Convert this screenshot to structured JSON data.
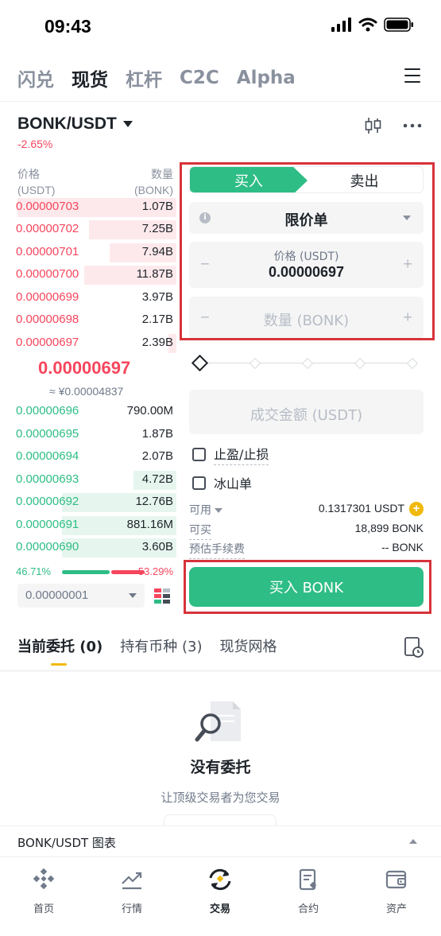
{
  "status": {
    "time": "09:43"
  },
  "top_tabs": [
    {
      "label": "闪兑",
      "active": false
    },
    {
      "label": "现货",
      "active": true
    },
    {
      "label": "杠杆",
      "active": false
    },
    {
      "label": "C2C",
      "active": false
    },
    {
      "label": "Alpha",
      "active": false
    }
  ],
  "pair": {
    "name": "BONK/USDT",
    "change": "-2.65%"
  },
  "orderbook": {
    "price_header": "价格",
    "price_unit": "(USDT)",
    "qty_header": "数量",
    "qty_unit": "(BONK)",
    "asks": [
      {
        "price": "0.00000703",
        "qty": "1.07B",
        "depth": 1.0
      },
      {
        "price": "0.00000702",
        "qty": "7.25B",
        "depth": 0.55
      },
      {
        "price": "0.00000701",
        "qty": "7.94B",
        "depth": 0.42
      },
      {
        "price": "0.00000700",
        "qty": "11.87B",
        "depth": 0.58
      },
      {
        "price": "0.00000699",
        "qty": "3.97B",
        "depth": 0.0
      },
      {
        "price": "0.00000698",
        "qty": "2.17B",
        "depth": 0.0
      },
      {
        "price": "0.00000697",
        "qty": "2.39B",
        "depth": 0.05
      }
    ],
    "last_price": "0.00000697",
    "last_fiat": "≈ ¥0.00004837",
    "bids": [
      {
        "price": "0.00000696",
        "qty": "790.00M",
        "depth": 0.0
      },
      {
        "price": "0.00000695",
        "qty": "1.87B",
        "depth": 0.0
      },
      {
        "price": "0.00000694",
        "qty": "2.07B",
        "depth": 0.0
      },
      {
        "price": "0.00000693",
        "qty": "4.72B",
        "depth": 0.27
      },
      {
        "price": "0.00000692",
        "qty": "12.76B",
        "depth": 0.72
      },
      {
        "price": "0.00000691",
        "qty": "881.16M",
        "depth": 0.72
      },
      {
        "price": "0.00000690",
        "qty": "3.60B",
        "depth": 0.72
      }
    ],
    "buy_ratio": "46.71%",
    "sell_ratio": "53.29%",
    "precision": "0.00000001"
  },
  "form": {
    "buy_label": "买入",
    "sell_label": "卖出",
    "order_type": "限价单",
    "price_label": "价格 (USDT)",
    "price_value": "0.00000697",
    "qty_placeholder": "数量 (BONK)",
    "amount_placeholder": "成交金额 (USDT)",
    "tp_sl": "止盈/止损",
    "iceberg": "冰山单",
    "available_label": "可用",
    "available_value": "0.1317301 USDT",
    "can_buy_label": "可买",
    "can_buy_value": "18,899 BONK",
    "fee_label": "预估手续费",
    "fee_value": "-- BONK",
    "submit_label": "买入 BONK"
  },
  "order_tabs": [
    {
      "label": "当前委托 (0)",
      "active": true
    },
    {
      "label": "持有币种 (3)",
      "active": false
    },
    {
      "label": "现货网格",
      "active": false
    }
  ],
  "empty": {
    "title": "没有委托",
    "subtitle": "让顶级交易者为您交易"
  },
  "chart_bar": {
    "title": "BONK/USDT 图表"
  },
  "bottom_nav": [
    {
      "label": "首页",
      "icon": "home-icon",
      "active": false
    },
    {
      "label": "行情",
      "icon": "markets-icon",
      "active": false
    },
    {
      "label": "交易",
      "icon": "trade-icon",
      "active": true
    },
    {
      "label": "合约",
      "icon": "futures-icon",
      "active": false
    },
    {
      "label": "资产",
      "icon": "wallet-icon",
      "active": false
    }
  ],
  "colors": {
    "buy": "#2ebd85",
    "sell": "#f6465d",
    "accent": "#f0b90b",
    "highlight_box": "#d7333a"
  }
}
